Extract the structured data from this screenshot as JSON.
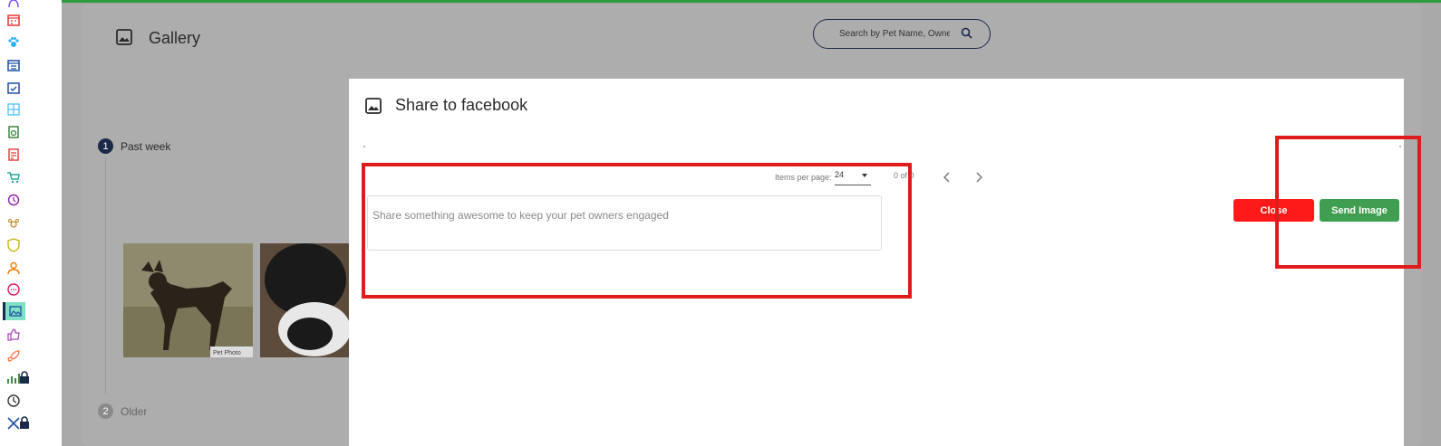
{
  "gallery": {
    "title": "Gallery",
    "search_placeholder": "Search by Pet Name, Owner"
  },
  "timeline": {
    "steps": [
      {
        "number": "1",
        "label": "Past week"
      },
      {
        "number": "2",
        "label": "Older"
      }
    ]
  },
  "thumbnails": [
    {
      "caption": "Pet Photo",
      "colors": [
        "#8f8a6e",
        "#2a2319"
      ]
    },
    {
      "caption": "",
      "colors": [
        "#5c4a3a",
        "#1a1a1a"
      ]
    }
  ],
  "modal": {
    "title": "Share to facebook",
    "pager": {
      "items_per_page_label": "Items per page:",
      "items_per_page_value": "24",
      "range_text": "0 of 0"
    },
    "textarea_placeholder": "Share something awesome to keep your pet owners engaged",
    "close_label": "Close",
    "send_label": "Send Image"
  },
  "colors": {
    "brand_green": "#2e9c3e",
    "close_red": "#ff1a1a",
    "send_green": "#3f9e4f",
    "annotation_red": "#e01b1b",
    "active_nav": "#7ee0c6"
  }
}
